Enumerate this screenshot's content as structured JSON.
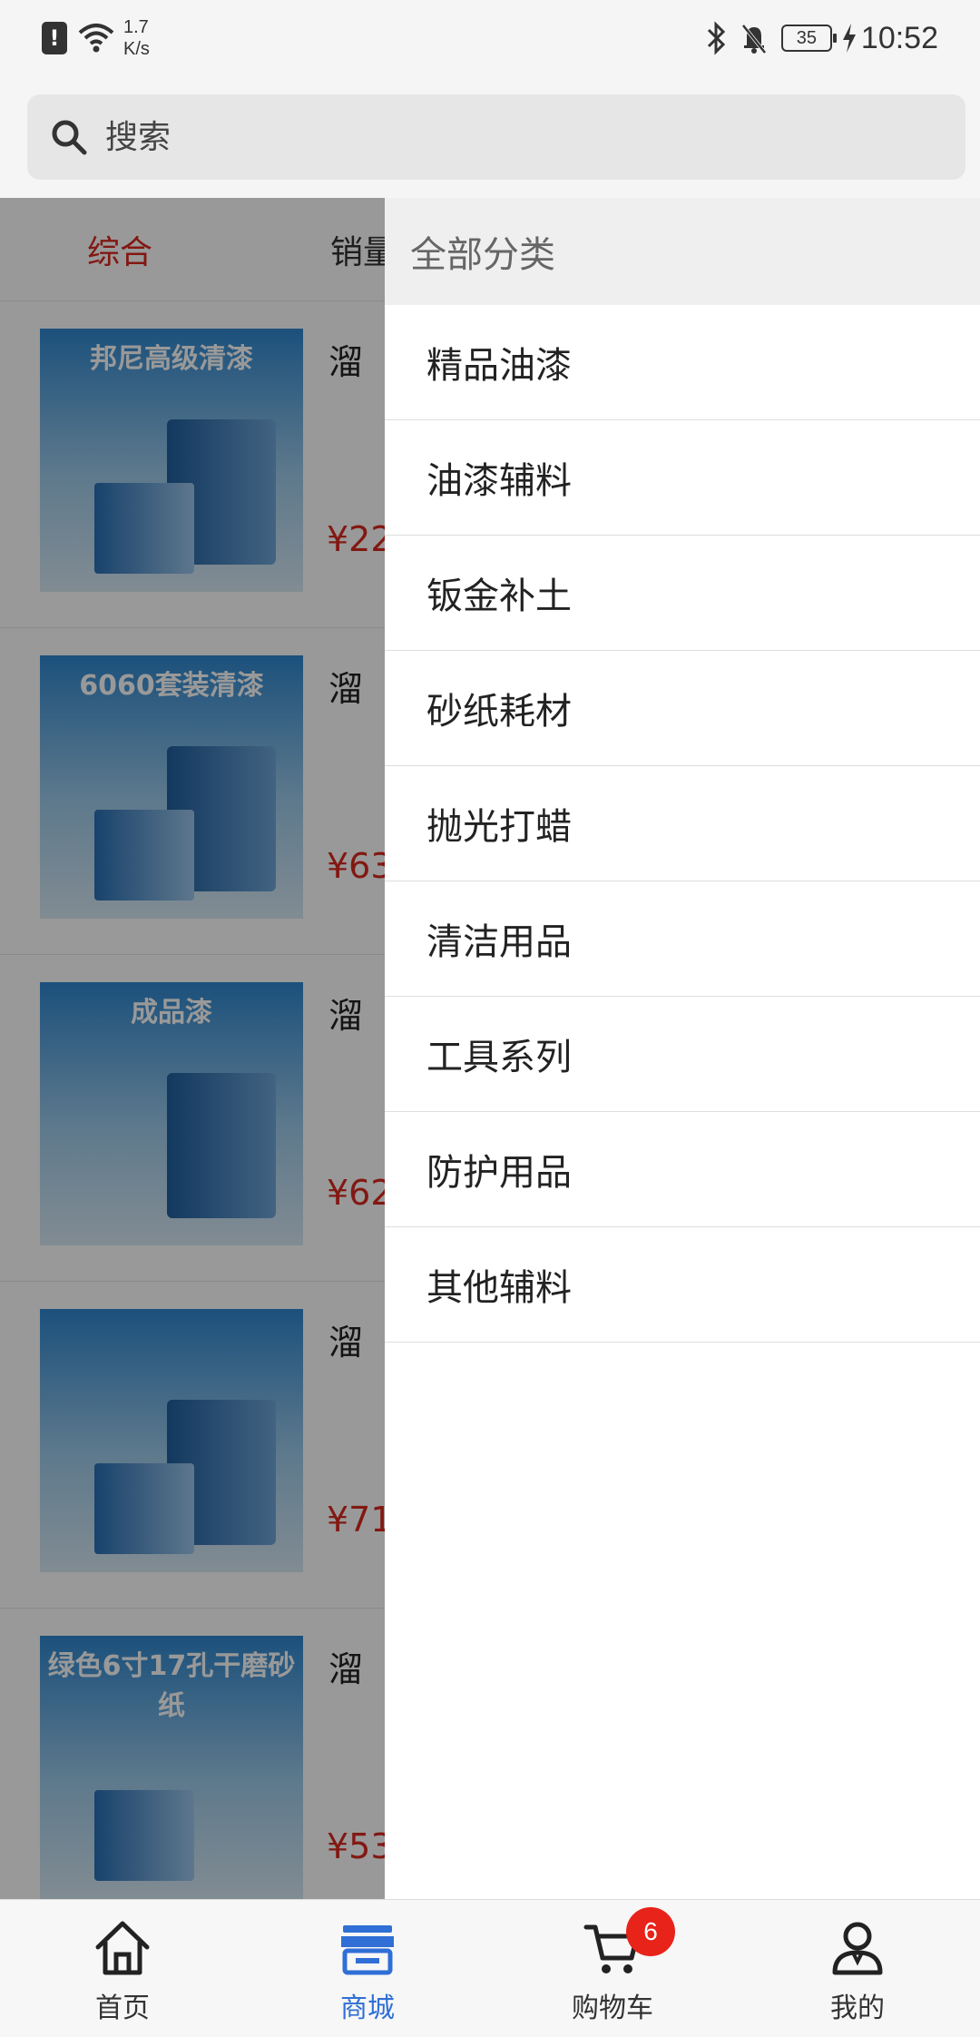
{
  "status_bar": {
    "net_speed_value": "1.7",
    "net_speed_unit": "K/s",
    "battery": "35",
    "time": "10:52"
  },
  "search": {
    "placeholder": "搜索"
  },
  "sort_tabs": [
    {
      "label": "综合"
    },
    {
      "label": "销量"
    }
  ],
  "products": [
    {
      "name": "溜",
      "price": "¥22",
      "image_title": "邦尼高级清漆"
    },
    {
      "name": "溜",
      "price": "¥63",
      "image_title": "6060套装清漆"
    },
    {
      "name": "溜",
      "price": "¥62",
      "image_title": "成品漆"
    },
    {
      "name": "溜",
      "price": "¥71",
      "image_title": ""
    },
    {
      "name": "溜",
      "price": "¥53",
      "image_title": "绿色6寸17孔干磨砂纸"
    }
  ],
  "drawer": {
    "header": "全部分类",
    "categories": [
      "精品油漆",
      "油漆辅料",
      "钣金补土",
      "砂纸耗材",
      "抛光打蜡",
      "清洁用品",
      "工具系列",
      "防护用品",
      "其他辅料"
    ]
  },
  "bottom_nav": {
    "items": [
      {
        "label": "首页",
        "icon": "home-icon"
      },
      {
        "label": "商城",
        "icon": "store-icon"
      },
      {
        "label": "购物车",
        "icon": "cart-icon"
      },
      {
        "label": "我的",
        "icon": "profile-icon"
      }
    ],
    "active": "商城",
    "cart_badge": "6"
  },
  "colors": {
    "accent_red": "#d9281f",
    "nav_active": "#2f6fd6",
    "badge_red": "#e8231a"
  }
}
